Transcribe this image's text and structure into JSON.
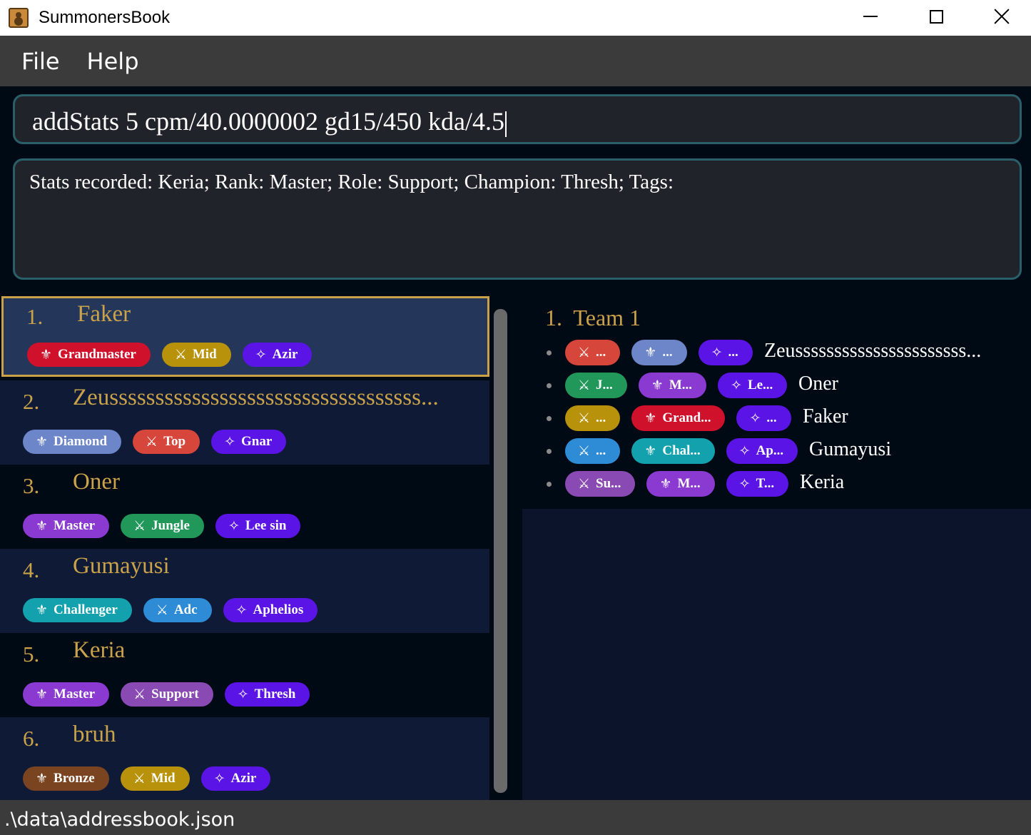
{
  "window": {
    "title": "SummonersBook"
  },
  "menu": {
    "items": [
      "File",
      "Help"
    ]
  },
  "command": {
    "value": "addStats 5 cpm/40.0000002 gd15/450 kda/4.5"
  },
  "result": {
    "text": "Stats recorded: Keria; Rank: Master; Role: Support; Champion: Thresh; Tags:"
  },
  "icons": {
    "rank": "fleur-de-lis-icon",
    "role": "crossed-swords-icon",
    "champion": "sparkle-icon"
  },
  "persons": [
    {
      "index": "1.",
      "name": "Faker",
      "tags": [
        {
          "label": "Grandmaster",
          "type": "rank",
          "color": "#d0112b"
        },
        {
          "label": "Mid",
          "type": "role",
          "color": "#b8920a"
        },
        {
          "label": "Azir",
          "type": "champion",
          "color": "#5b14e6"
        }
      ]
    },
    {
      "index": "2.",
      "name": "Zeussssssssssssssssssssssssssssssssss...",
      "tags": [
        {
          "label": "Diamond",
          "type": "rank",
          "color": "#6d86c9"
        },
        {
          "label": "Top",
          "type": "role",
          "color": "#d7463b"
        },
        {
          "label": "Gnar",
          "type": "champion",
          "color": "#5b14e6"
        }
      ]
    },
    {
      "index": "3.",
      "name": "Oner",
      "tags": [
        {
          "label": "Master",
          "type": "rank",
          "color": "#8a3ad1"
        },
        {
          "label": "Jungle",
          "type": "role",
          "color": "#22975a"
        },
        {
          "label": "Lee sin",
          "type": "champion",
          "color": "#5b14e6"
        }
      ]
    },
    {
      "index": "4.",
      "name": "Gumayusi",
      "tags": [
        {
          "label": "Challenger",
          "type": "rank",
          "color": "#13a1ad"
        },
        {
          "label": "Adc",
          "type": "role",
          "color": "#2e8bd6"
        },
        {
          "label": "Aphelios",
          "type": "champion",
          "color": "#5b14e6"
        }
      ]
    },
    {
      "index": "5.",
      "name": "Keria",
      "tags": [
        {
          "label": "Master",
          "type": "rank",
          "color": "#8a3ad1"
        },
        {
          "label": "Support",
          "type": "role",
          "color": "#8a4ab3"
        },
        {
          "label": "Thresh",
          "type": "champion",
          "color": "#5b14e6"
        }
      ]
    },
    {
      "index": "6.",
      "name": "bruh",
      "tags": [
        {
          "label": "Bronze",
          "type": "rank",
          "color": "#7a4421"
        },
        {
          "label": "Mid",
          "type": "role",
          "color": "#b8920a"
        },
        {
          "label": "Azir",
          "type": "champion",
          "color": "#5b14e6"
        }
      ]
    }
  ],
  "team": {
    "index": "1.",
    "title": "Team 1",
    "members": [
      {
        "name": "Zeussssssssssssssssssssss...",
        "tags": [
          {
            "label": "...",
            "type": "role",
            "color": "#d7463b"
          },
          {
            "label": "...",
            "type": "rank",
            "color": "#6d86c9"
          },
          {
            "label": "...",
            "type": "champion",
            "color": "#5b14e6"
          }
        ]
      },
      {
        "name": "Oner",
        "tags": [
          {
            "label": "J...",
            "type": "role",
            "color": "#22975a"
          },
          {
            "label": "M...",
            "type": "rank",
            "color": "#8a3ad1"
          },
          {
            "label": "Le...",
            "type": "champion",
            "color": "#5b14e6"
          }
        ]
      },
      {
        "name": "Faker",
        "tags": [
          {
            "label": "...",
            "type": "role",
            "color": "#b8920a"
          },
          {
            "label": "Grand...",
            "type": "rank",
            "color": "#d0112b"
          },
          {
            "label": "...",
            "type": "champion",
            "color": "#5b14e6"
          }
        ]
      },
      {
        "name": "Gumayusi",
        "tags": [
          {
            "label": "...",
            "type": "role",
            "color": "#2e8bd6"
          },
          {
            "label": "Chal...",
            "type": "rank",
            "color": "#13a1ad"
          },
          {
            "label": "Ap...",
            "type": "champion",
            "color": "#5b14e6"
          }
        ]
      },
      {
        "name": "Keria",
        "tags": [
          {
            "label": "Su...",
            "type": "role",
            "color": "#8a4ab3"
          },
          {
            "label": "M...",
            "type": "rank",
            "color": "#8a3ad1"
          },
          {
            "label": "T...",
            "type": "champion",
            "color": "#5b14e6"
          }
        ]
      }
    ]
  },
  "status": {
    "path": ".\\data\\addressbook.json"
  }
}
